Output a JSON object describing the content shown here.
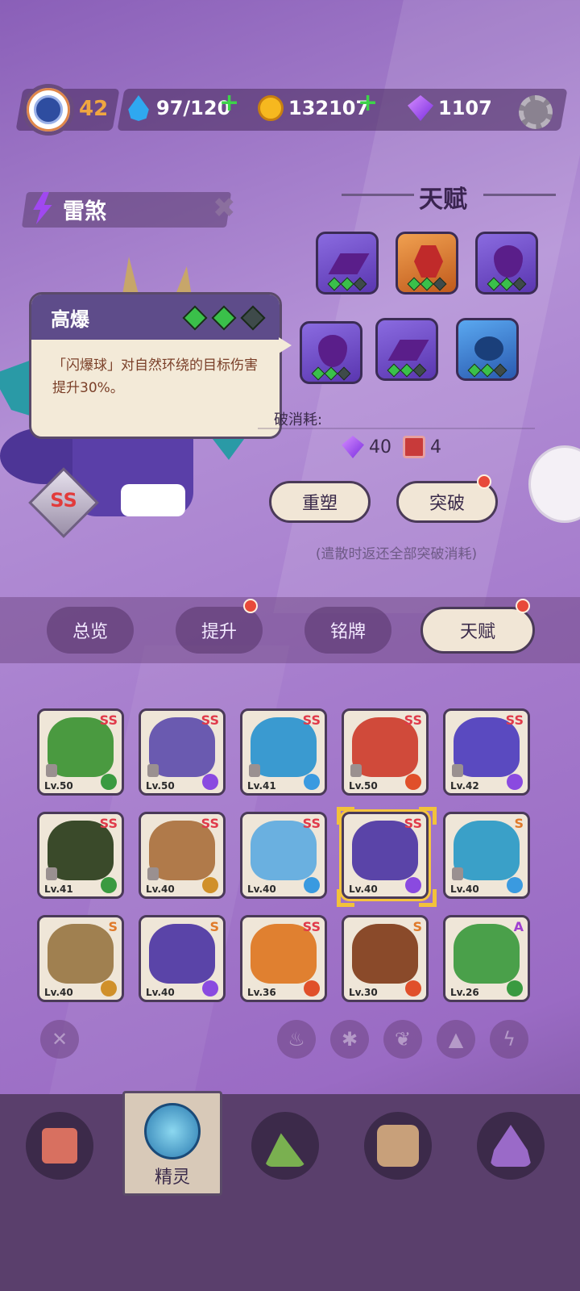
{
  "topbar": {
    "level": "42",
    "water": "97/120",
    "coins": "132107",
    "gems": "1107"
  },
  "pet": {
    "name": "雷煞",
    "rank": "SS"
  },
  "tooltip": {
    "title": "高爆",
    "pips": [
      true,
      true,
      false
    ],
    "description": "「闪爆球」对自然环绕的目标伤害提升30%。"
  },
  "talent": {
    "title": "天赋",
    "tiles": [
      {
        "kind": "p",
        "sym": "plates",
        "pips": [
          true,
          true,
          false
        ]
      },
      {
        "kind": "o",
        "sym": "hex",
        "pips": [
          true,
          true,
          false
        ]
      },
      {
        "kind": "p",
        "sym": "drop",
        "pips": [
          true,
          true,
          false
        ]
      },
      {
        "kind": "p",
        "sym": "drop",
        "pips": [
          true,
          true,
          false
        ]
      },
      {
        "kind": "p",
        "sym": "plates",
        "pips": [
          true,
          true,
          false
        ]
      },
      {
        "kind": "b",
        "sym": "eye",
        "pips": [
          true,
          true,
          false
        ]
      }
    ],
    "cost_label": "破消耗:",
    "cost_gems": "40",
    "cost_items": "4",
    "reshape": "重塑",
    "breakthrough": "突破",
    "note": "(遣散时返还全部突破消耗)"
  },
  "tabs": [
    "总览",
    "提升",
    "铭牌",
    "天赋"
  ],
  "pets": [
    {
      "rank": "SS",
      "lv": "Lv.50",
      "color": "#4a9a40",
      "el": "#3a9a40"
    },
    {
      "rank": "SS",
      "lv": "Lv.50",
      "color": "#6a5ab0",
      "el": "#8a4ae0"
    },
    {
      "rank": "SS",
      "lv": "Lv.41",
      "color": "#3a9ad0",
      "el": "#3a9ae0"
    },
    {
      "rank": "SS",
      "lv": "Lv.50",
      "color": "#d04a3a",
      "el": "#e0502a"
    },
    {
      "rank": "SS",
      "lv": "Lv.42",
      "color": "#5a4ac0",
      "el": "#8a4ae0"
    },
    {
      "rank": "SS",
      "lv": "Lv.41",
      "color": "#3a4a2a",
      "el": "#3a9a40"
    },
    {
      "rank": "SS",
      "lv": "Lv.40",
      "color": "#b07a4a",
      "el": "#d0902a"
    },
    {
      "rank": "SS",
      "lv": "Lv.40",
      "color": "#6ab0e0",
      "el": "#3a9ae0"
    },
    {
      "rank": "SS",
      "lv": "Lv.40",
      "color": "#5a44a8",
      "el": "#8a4ae0"
    },
    {
      "rank": "S",
      "lv": "Lv.40",
      "color": "#3aa0c8",
      "el": "#3a9ae0"
    },
    {
      "rank": "S",
      "lv": "Lv.40",
      "color": "#a08050",
      "el": "#d0902a"
    },
    {
      "rank": "S",
      "lv": "Lv.40",
      "color": "#5a44a8",
      "el": "#8a4ae0"
    },
    {
      "rank": "SS",
      "lv": "Lv.36",
      "color": "#e08030",
      "el": "#e0502a"
    },
    {
      "rank": "S",
      "lv": "Lv.30",
      "color": "#8a4a2a",
      "el": "#e0502a"
    },
    {
      "rank": "A",
      "lv": "Lv.26",
      "color": "#4aa04a",
      "el": "#3a9a40"
    }
  ],
  "nav": {
    "active_label": "精灵"
  }
}
